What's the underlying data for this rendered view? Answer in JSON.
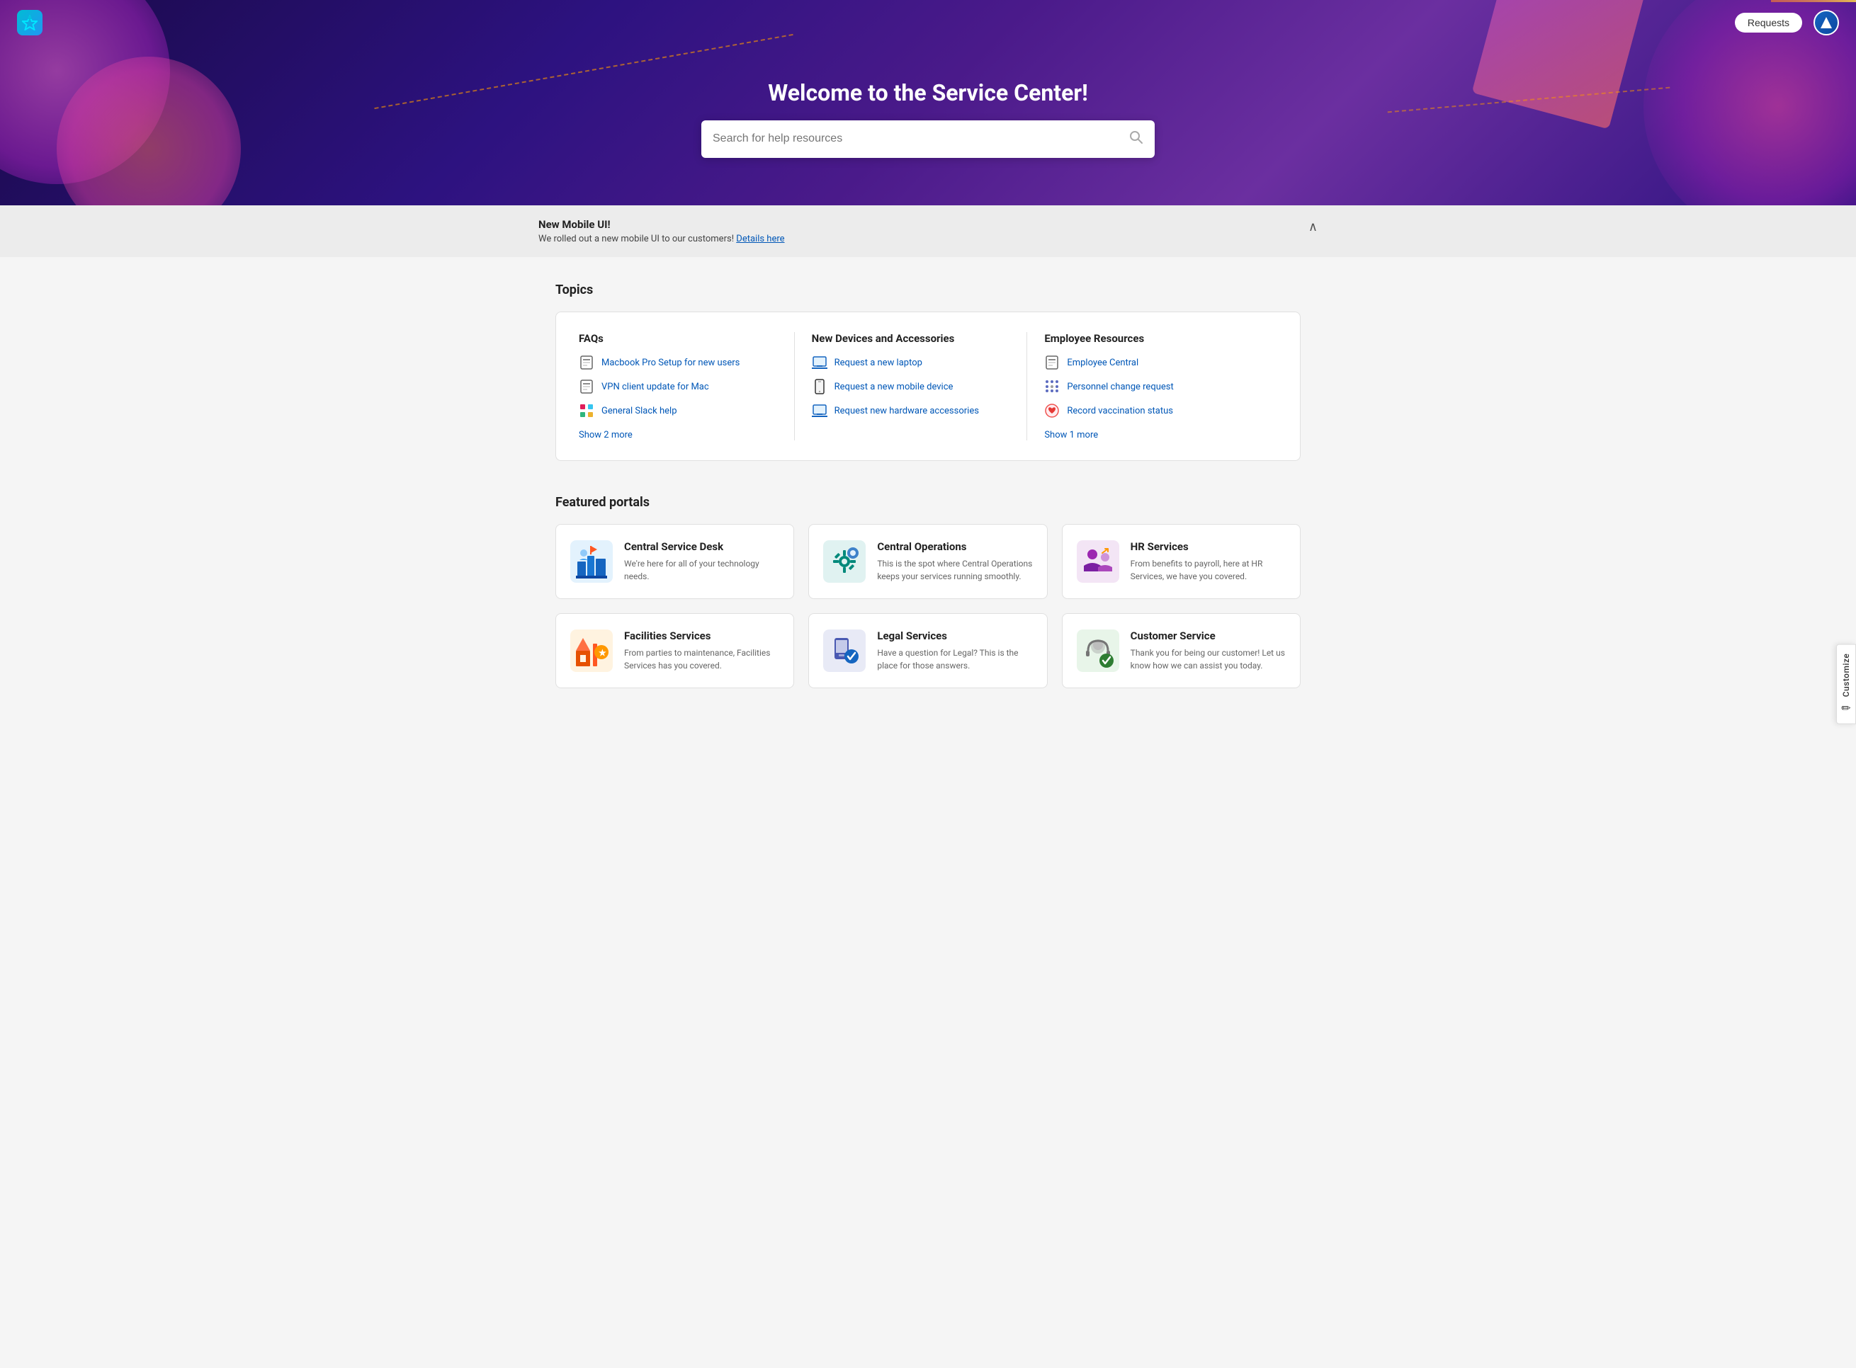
{
  "nav": {
    "requests_label": "Requests",
    "avatar_icon": "▲"
  },
  "hero": {
    "title": "Welcome to the Service Center!",
    "search_placeholder": "Search for help resources"
  },
  "customize": {
    "label": "Customize",
    "pencil_icon": "✏"
  },
  "announcement": {
    "title": "New Mobile UI!",
    "body": "We rolled out a new mobile UI to our customers!",
    "link_text": "Details here",
    "chevron": "∧"
  },
  "topics": {
    "section_title": "Topics",
    "columns": [
      {
        "title": "FAQs",
        "items": [
          {
            "text": "Macbook Pro Setup for new users",
            "icon": "doc"
          },
          {
            "text": "VPN client update for Mac",
            "icon": "doc"
          },
          {
            "text": "General Slack help",
            "icon": "slack"
          }
        ],
        "show_more": "Show 2 more"
      },
      {
        "title": "New Devices and Accessories",
        "items": [
          {
            "text": "Request a new laptop",
            "icon": "laptop"
          },
          {
            "text": "Request a new mobile device",
            "icon": "mobile"
          },
          {
            "text": "Request new hardware accessories",
            "icon": "laptop2"
          }
        ],
        "show_more": null
      },
      {
        "title": "Employee Resources",
        "items": [
          {
            "text": "Employee Central",
            "icon": "doc"
          },
          {
            "text": "Personnel change request",
            "icon": "grid"
          },
          {
            "text": "Record vaccination status",
            "icon": "heart"
          }
        ],
        "show_more": "Show 1 more"
      }
    ]
  },
  "featured_portals": {
    "section_title": "Featured portals",
    "portals": [
      {
        "title": "Central Service Desk",
        "desc": "We're here for all of your technology needs.",
        "icon_color": "#1565c0"
      },
      {
        "title": "Central Operations",
        "desc": "This is the spot where Central Operations keeps your services running smoothly.",
        "icon_color": "#00897b"
      },
      {
        "title": "HR Services",
        "desc": "From benefits to payroll, here at HR Services, we have you covered.",
        "icon_color": "#7b1fa2"
      },
      {
        "title": "Facilities Services",
        "desc": "From parties to maintenance, Facilities Services has you covered.",
        "icon_color": "#e65100"
      },
      {
        "title": "Legal Services",
        "desc": "Have a question for Legal? This is the place for those answers.",
        "icon_color": "#283593"
      },
      {
        "title": "Customer Service",
        "desc": "Thank you for being our customer! Let us know how we can assist you today.",
        "icon_color": "#2e7d32"
      }
    ]
  }
}
